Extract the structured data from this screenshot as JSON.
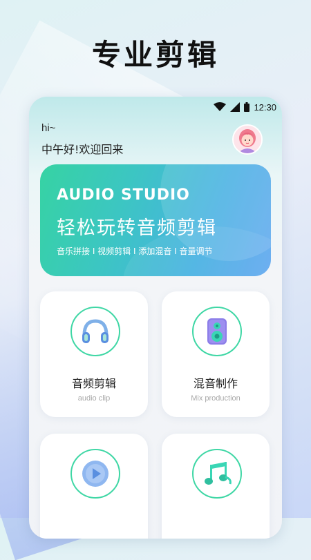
{
  "headline": "专业剪辑",
  "status": {
    "time": "12:30"
  },
  "greeting": {
    "hi": "hi~",
    "message": "中午好!欢迎回来"
  },
  "banner": {
    "title": "AUDIO STUDIO",
    "subtitle": "轻松玩转音频剪辑",
    "tags": "音乐拼接 I 视频剪辑 I 添加混音 I 音量调节"
  },
  "features": [
    {
      "title": "音频剪辑",
      "subtitle": "audio clip",
      "icon": "headphones-icon"
    },
    {
      "title": "混音制作",
      "subtitle": "Mix production",
      "icon": "speaker-icon"
    },
    {
      "title": "",
      "subtitle": "",
      "icon": "play-icon"
    },
    {
      "title": "",
      "subtitle": "",
      "icon": "music-note-icon"
    }
  ],
  "colors": {
    "accent": "#3fd7a5",
    "banner_start": "#36d3a3",
    "banner_end": "#63a8f0"
  }
}
